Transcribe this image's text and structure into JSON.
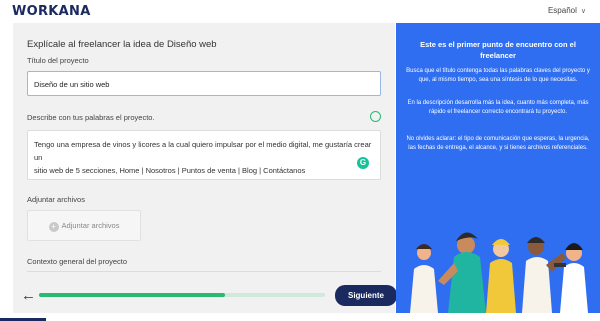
{
  "brand": {
    "logo": "WORKANA"
  },
  "header": {
    "language": "Español"
  },
  "form": {
    "heading": "Explícale al freelancer la idea de Diseño web",
    "title_label": "Título del proyecto",
    "title_value": "Diseño de un  sitio web",
    "description_label": "Describe con tus palabras el proyecto.",
    "description_lines": [
      "Tengo una empresa de vinos y licores a la cual quiero impulsar por el medio digital, me gustaría crear un",
      "sitio web de 5 secciones, Home | Nosotros | Puntos de venta | Blog | Contáctanos"
    ],
    "attach_label": "Adjuntar archivos",
    "attach_button": "Adjuntar archivos",
    "context_label": "Contexto general del proyecto"
  },
  "footer": {
    "back_icon": "arrow-left-icon",
    "progress": 0.65,
    "next_button": "Siguiente"
  },
  "tips": {
    "title": "Este es el primer punto de encuentro con el freelancer",
    "paragraph1": "Busca que el título contenga todas las palabras claves del proyecto y que, al mismo tiempo, sea una síntesis de lo que necesitas.",
    "paragraph2": "En la descripción desarrolla más la idea, cuanto más completa, más rápido el freelancer correcto encontrará tu proyecto.",
    "paragraph3": "No olvides aclarar: el tipo de comunicación que esperas, la urgencia, las fechas de entrega, el alcance, y si tienes archivos referenciales."
  },
  "colors": {
    "accent": "#2f6ef0",
    "primary": "#1a2a5e",
    "success": "#2ab872"
  }
}
